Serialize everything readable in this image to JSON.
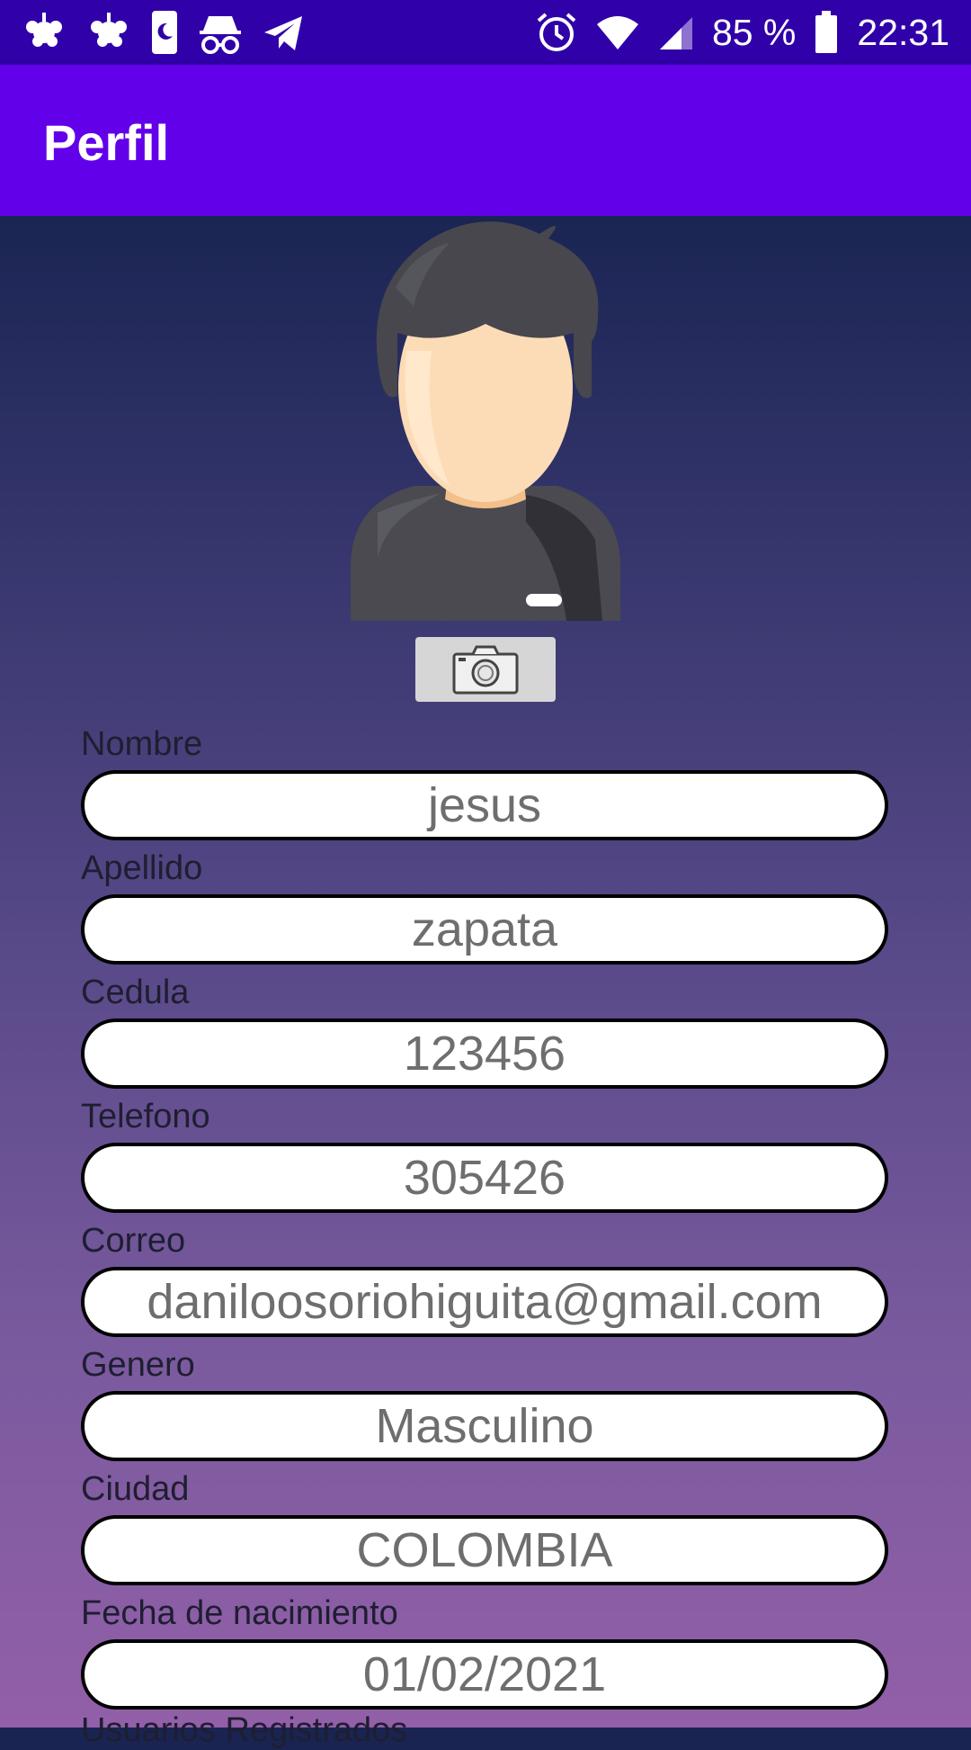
{
  "status_bar": {
    "battery": "85 %",
    "time": "22:31",
    "icons": [
      "weather-icon",
      "weather-icon",
      "phone-night-icon",
      "incognito-icon",
      "telegram-icon",
      "alarm-icon",
      "wifi-icon",
      "signal-icon",
      "battery-icon"
    ]
  },
  "app_bar": {
    "title": "Perfil"
  },
  "avatar": {
    "icon": "user-avatar-icon"
  },
  "camera": {
    "icon": "camera-icon"
  },
  "fields": [
    {
      "label": "Nombre",
      "value": "jesus"
    },
    {
      "label": "Apellido",
      "value": "zapata"
    },
    {
      "label": "Cedula",
      "value": "123456"
    },
    {
      "label": "Telefono",
      "value": "305426"
    },
    {
      "label": "Correo",
      "value": "daniloosoriohiguita@gmail.com"
    },
    {
      "label": "Genero",
      "value": "Masculino"
    },
    {
      "label": "Ciudad",
      "value": "COLOMBIA"
    },
    {
      "label": "Fecha de nacimiento",
      "value": "01/02/2021"
    },
    {
      "label": "Usuarios Registrados"
    }
  ],
  "colors": {
    "status_bar": "#3000a8",
    "app_bar": "#6200ea",
    "gradient_top": "#1a2553",
    "gradient_bottom": "#925fa8"
  }
}
